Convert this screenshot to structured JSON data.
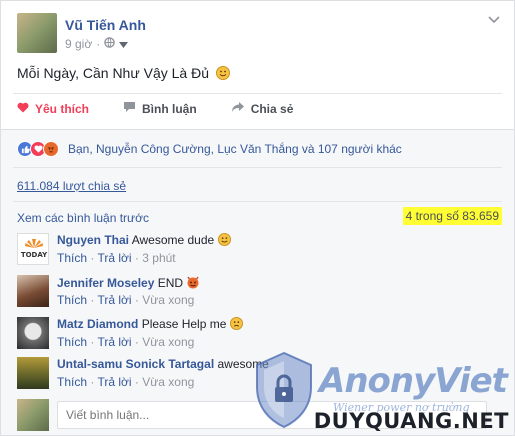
{
  "post": {
    "author": "Vũ Tiến Anh",
    "time": "9 giờ",
    "text": "Mỗi Ngày, Cần Như Vậy Là Đủ"
  },
  "actions": {
    "like": "Yêu thích",
    "comment": "Bình luận",
    "share": "Chia sẻ"
  },
  "reactions": {
    "text": "Bạn, Nguyễn Công Cường, Lục Văn Thắng và 107 người khác",
    "icons": [
      "like-icon",
      "love-icon",
      "angry-icon"
    ]
  },
  "shares": "611.084 lượt chia sẻ",
  "comments_header": {
    "view_previous": "Xem các bình luận trước",
    "count": "4 trong số 83.659"
  },
  "comment_actions": {
    "like": "Thích",
    "reply": "Trả lời",
    "sep": "·"
  },
  "comments": [
    {
      "name": "Nguyen Thai",
      "text": "Awesome dude",
      "time": "3 phút",
      "avatar_text": "TODAY"
    },
    {
      "name": "Jennifer Moseley",
      "text": "END",
      "time": "Vừa xong"
    },
    {
      "name": "Matz Diamond",
      "text": "Please Help me",
      "time": "Vừa xong"
    },
    {
      "name": "Untal-samu Sonick Tartagal",
      "text": "awesome",
      "time": "Vừa xong"
    }
  ],
  "write_comment": {
    "placeholder": "Viết bình luận..."
  },
  "watermark": {
    "brand": "AnonyViet",
    "sub": "Wiener power nợ trường",
    "site": "DUYQUANG.NET"
  },
  "colors": {
    "link": "#365899",
    "liked": "#f33e58",
    "highlight": "#ffff33"
  }
}
